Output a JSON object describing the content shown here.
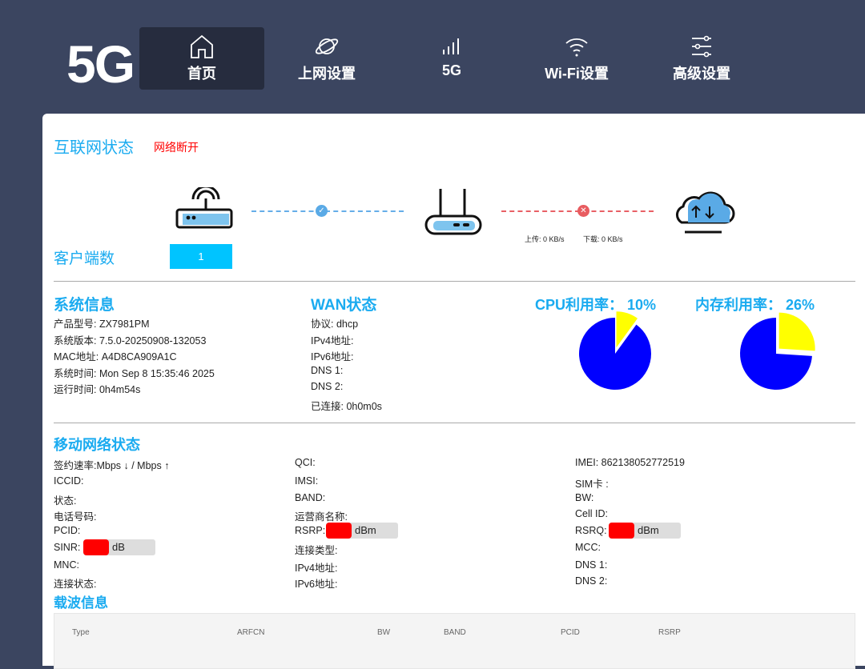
{
  "logo": "5G",
  "nav": [
    {
      "label": "首页",
      "icon": "home-icon"
    },
    {
      "label": "上网设置",
      "icon": "planet-icon"
    },
    {
      "label": "5G",
      "icon": "signal-icon"
    },
    {
      "label": "Wi-Fi设置",
      "icon": "wifi-icon"
    },
    {
      "label": "高级设置",
      "icon": "sliders-icon"
    }
  ],
  "internet": {
    "title": "互联网状态",
    "status": "网络断开",
    "clients_label": "客户端数",
    "clients": "1",
    "upload": "上传: 0 KB/s",
    "download": "下载: 0 KB/s"
  },
  "system": {
    "title": "系统信息",
    "rows": [
      "产品型号: ZX7981PM",
      "系统版本: 7.5.0-20250908-132053",
      "MAC地址: A4D8CA909A1C",
      "系统时间: Mon Sep 8 15:35:46 2025",
      "运行时间: 0h4m54s"
    ]
  },
  "wan": {
    "title": "WAN状态",
    "rows": [
      "协议: dhcp",
      "IPv4地址:",
      "IPv6地址:",
      "DNS 1:",
      "DNS 2:",
      "已连接: 0h0m0s"
    ]
  },
  "cpu": {
    "label": "CPU利用率：",
    "value": "10%",
    "percent": 10
  },
  "mem": {
    "label": "内存利用率：",
    "value": "26%",
    "percent": 26
  },
  "colors": {
    "used": "#ffff00",
    "free": "#0000ff",
    "accent": "#1aabf0"
  },
  "mobile": {
    "title": "移动网络状态",
    "col1": [
      "签约速率:Mbps ↓ / Mbps ↑",
      "ICCID:",
      "状态:",
      "电话号码:",
      "PCID:",
      "SINR:",
      "MNC:",
      "连接状态:"
    ],
    "col2": [
      "QCI:",
      "IMSI:",
      "BAND:",
      "运营商名称:",
      "RSRP:",
      "连接类型:",
      "IPv4地址:",
      "IPv6地址:"
    ],
    "col3": [
      "IMEI: 862138052772519",
      "SIM卡 :",
      "BW:",
      "Cell ID:",
      "RSRQ:",
      "MCC:",
      "DNS 1:",
      "DNS 2:"
    ],
    "sinr_unit": "dB",
    "rsrp_unit": "dBm",
    "rsrq_unit": "dBm"
  },
  "carrier": {
    "title": "载波信息",
    "headers": [
      "Type",
      "ARFCN",
      "BW",
      "BAND",
      "PCID",
      "RSRP"
    ]
  }
}
